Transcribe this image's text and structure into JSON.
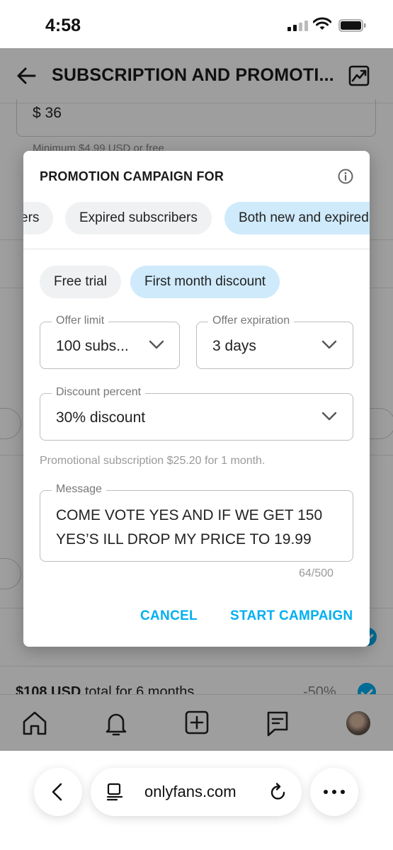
{
  "status_bar": {
    "time": "4:58"
  },
  "header": {
    "title": "SUBSCRIPTION AND PROMOTI..."
  },
  "background": {
    "price_value": "$ 36",
    "price_min_note": "Minimum $4.99 USD or free",
    "bundle_total": "$108 USD",
    "bundle_total_suffix": "total for 6 months",
    "bundle_discount": "-50%"
  },
  "dialog": {
    "title": "PROMOTION CAMPAIGN FOR",
    "audience_chips": [
      {
        "label": "New subscribers"
      },
      {
        "label": "Expired subscribers"
      },
      {
        "label": "Both new and expired subscribers",
        "selected": true
      }
    ],
    "type_chips": [
      {
        "label": "Free trial"
      },
      {
        "label": "First month discount",
        "selected": true
      }
    ],
    "offer_limit": {
      "label": "Offer limit",
      "value": "100 subs..."
    },
    "offer_expiration": {
      "label": "Offer expiration",
      "value": "3 days"
    },
    "discount_percent": {
      "label": "Discount percent",
      "value": "30% discount"
    },
    "promo_note": "Promotional subscription $25.20 for 1 month.",
    "message": {
      "label": "Message",
      "value": "COME VOTE YES AND IF WE GET 150 YES’S ILL DROP MY PRICE TO 19.99",
      "counter": "64/500"
    },
    "cancel_label": "CANCEL",
    "start_label": "START CAMPAIGN"
  },
  "browser": {
    "url": "onlyfans.com"
  },
  "colors": {
    "accent": "#00aff0",
    "chip_selected": "#cfeafb",
    "chip": "#eff1f3"
  },
  "icons": [
    "back-arrow-icon",
    "statistics-icon",
    "info-icon",
    "chevron-down-icon",
    "home-icon",
    "bell-icon",
    "add-post-icon",
    "messages-icon",
    "reader-icon",
    "reload-icon",
    "more-icon"
  ]
}
